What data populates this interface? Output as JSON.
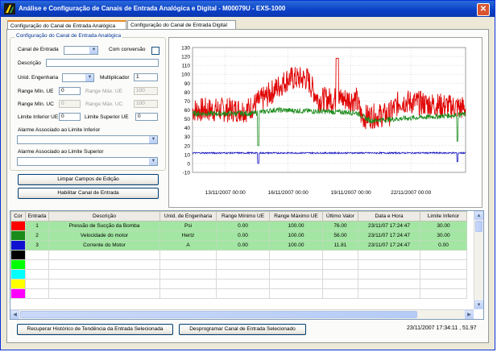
{
  "window": {
    "title": "Análise e Configuração de Canais de Entrada Analógica e Digital - M00079U - EXS-1000",
    "close": "✕"
  },
  "tabs": [
    "Configuração do Canal de Entrada Analógica",
    "Configuração do Canal de Entrada Digital"
  ],
  "config": {
    "group_title": "Configuração do Canal de Entrada Analógica",
    "canal_label": "Canal de Entrada",
    "canal_value": "",
    "conversao_label": "Com conversão",
    "conversao_checked": false,
    "descricao_label": "Descrição",
    "descricao_value": "",
    "unid_label": "Unid. Engenharia",
    "unid_value": "",
    "multiplicador_label": "Multiplicador",
    "multiplicador_value": "1",
    "range_min_ue_label": "Range Mín. UE",
    "range_min_ue_value": "0",
    "range_max_ue_label": "Range Máx. UE",
    "range_max_ue_value": "100",
    "range_min_uc_label": "Range Mín. UC",
    "range_min_uc_value": "0",
    "range_max_uc_label": "Range Máx. UC",
    "range_max_uc_value": "100",
    "lim_inf_label": "Limite Inferior UE",
    "lim_inf_value": "0",
    "lim_sup_label": "Limite Superior UE",
    "lim_sup_value": "0",
    "alarme_inf_label": "Alarme Associado ao Limite Inferior",
    "alarme_inf_value": "",
    "alarme_sup_label": "Alarme Associado ao Limite Superior",
    "alarme_sup_value": "",
    "limpar_button": "Limpar Campos de Edição",
    "habilitar_button": "Habilitar Canal de Entrada"
  },
  "chart_data": {
    "type": "line",
    "ylim": [
      -10,
      130
    ],
    "yticks": [
      "130",
      "120",
      "110",
      "100",
      "90",
      "80",
      "70",
      "60",
      "50",
      "40",
      "30",
      "20",
      "10",
      "0",
      "-10"
    ],
    "xticks": [
      "13/11/2007 00:00",
      "16/11/2007 00:00",
      "19/11/2007 00:00",
      "22/11/2007 00:00"
    ],
    "grid": true,
    "series": [
      {
        "color": "#e00000",
        "approx_levels": [
          [
            0,
            60
          ],
          [
            0.2,
            60
          ],
          [
            0.27,
            75
          ],
          [
            0.35,
            95
          ],
          [
            0.42,
            95
          ],
          [
            0.46,
            72
          ],
          [
            0.6,
            72
          ],
          [
            0.62,
            52
          ],
          [
            0.72,
            55
          ],
          [
            0.76,
            70
          ],
          [
            1,
            62
          ]
        ],
        "noise": 14
      },
      {
        "color": "#1a8a1a",
        "approx_levels": [
          [
            0,
            56
          ],
          [
            0.22,
            56
          ],
          [
            0.3,
            60
          ],
          [
            0.6,
            57
          ],
          [
            0.65,
            48
          ],
          [
            1,
            55
          ]
        ],
        "noise": 3
      },
      {
        "color": "#1010c0",
        "approx_levels": [
          [
            0,
            11.8
          ],
          [
            1,
            11.8
          ]
        ],
        "noise": 0.8
      }
    ]
  },
  "table": {
    "columns": [
      "Cor",
      "Entrada",
      "Descrição",
      "Unid. de Engenharia",
      "Range Mínimo UE",
      "Range Máximo UE",
      "Último Valor",
      "Data e Hora",
      "Limite Inferior"
    ],
    "rows": [
      {
        "color": "#ff0000",
        "cells": [
          "1",
          "Pressão de Sucção da Bomba",
          "Psi",
          "0.00",
          "100.00",
          "76.00",
          "23/11/07 17:24:47",
          "30.00"
        ]
      },
      {
        "color": "#1a8a1a",
        "cells": [
          "2",
          "Velocidade do motor",
          "Hertz",
          "0.00",
          "100.00",
          "56.00",
          "23/11/07 17:24:47",
          "30.00"
        ]
      },
      {
        "color": "#1010d0",
        "cells": [
          "3",
          "Corrente do Motor",
          "A",
          "0.00",
          "100.00",
          "11.81",
          "23/11/07 17:24:47",
          "0.00"
        ]
      }
    ],
    "empty_colors": [
      "#000000",
      "#00ff00",
      "#00ffff",
      "#ffff00",
      "#ff00ff"
    ]
  },
  "footer": {
    "recuperar_button": "Recuperar Histórico de Tendência da Entrada Selecionada",
    "desprogramar_button": "Desprogramar Canal de Entrada Selecionado",
    "clock": "23/11/2007 17:34:11 , 51.97"
  }
}
